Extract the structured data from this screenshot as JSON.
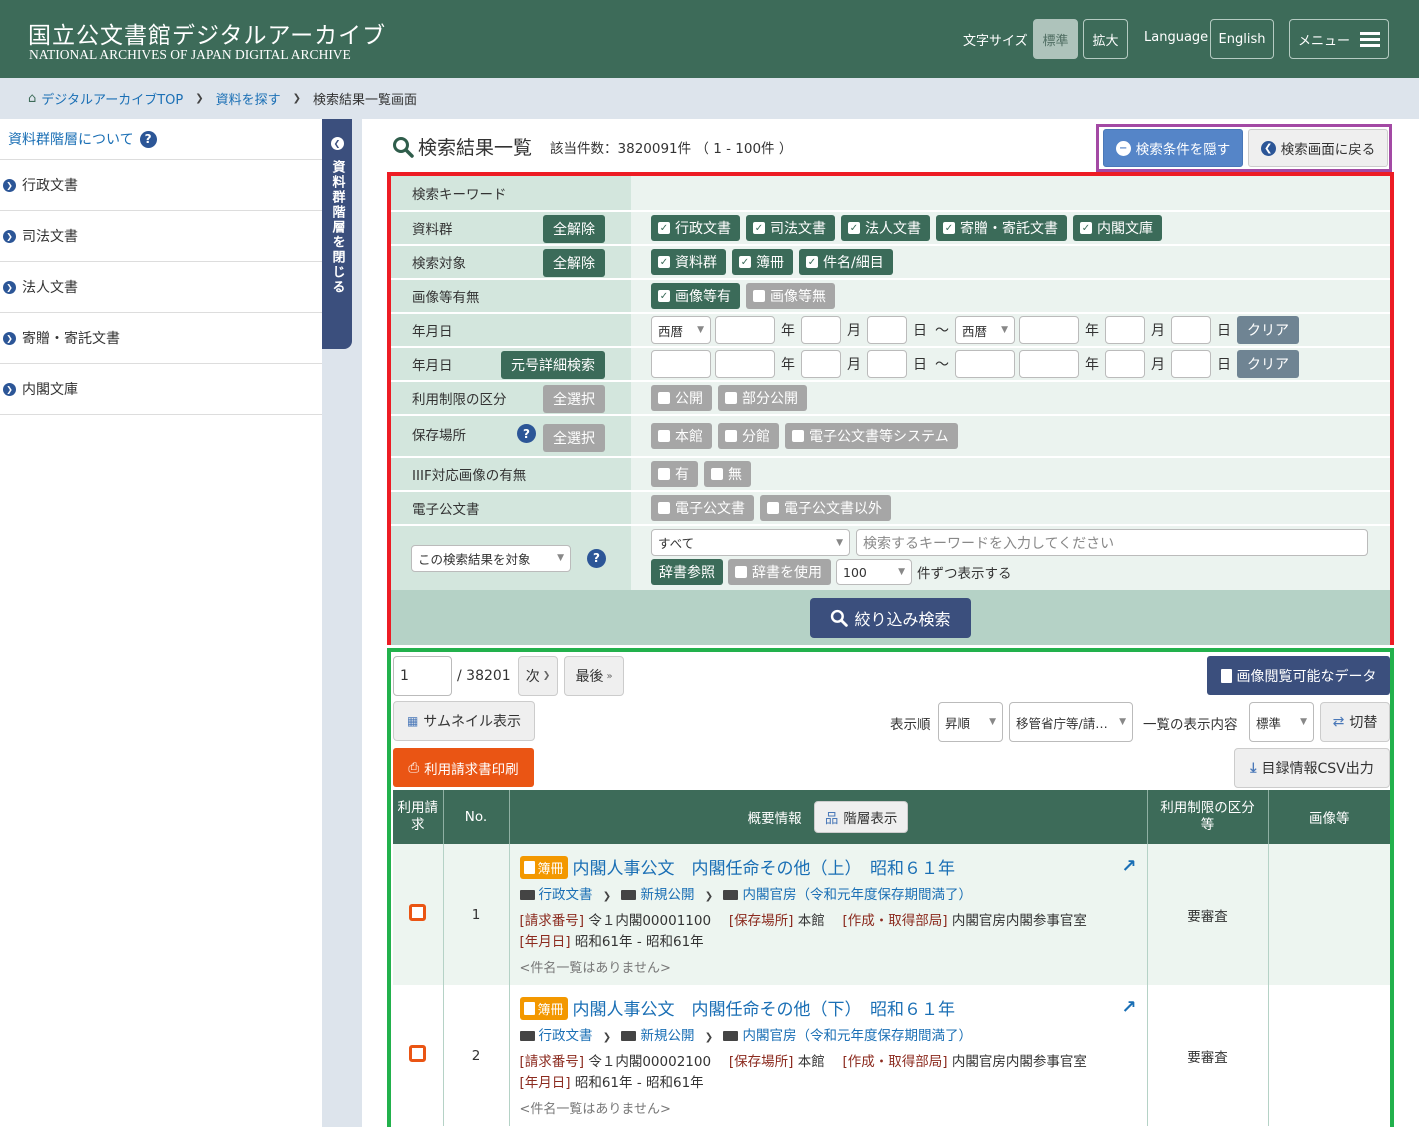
{
  "header": {
    "logo_jp": "国立公文書館デジタルアーカイブ",
    "logo_en": "NATIONAL ARCHIVES OF JAPAN  DIGITAL ARCHIVE",
    "font_size_label": "文字サイズ",
    "font_standard": "標準",
    "font_large": "拡大",
    "language_label": "Language",
    "language_button": "English",
    "menu_button": "メニュー"
  },
  "breadcrumb": {
    "home": "デジタルアーカイブTOP",
    "search": "資料を探す",
    "current": "検索結果一覧画面"
  },
  "sidebar": {
    "about": "資料群階層について",
    "items": [
      "行政文書",
      "司法文書",
      "法人文書",
      "寄贈・寄託文書",
      "内閣文庫"
    ],
    "toggle_label": "資料群階層を閉じる"
  },
  "title": {
    "text": "検索結果一覧",
    "count": "該当件数：3820091件 （ 1 - 100件 ）",
    "hide_conditions": "検索条件を隠す",
    "back_to_search": "検索画面に戻る"
  },
  "search": {
    "keyword_label": "検索キーワード",
    "collection_label": "資料群",
    "collection_btn": "全解除",
    "collections": [
      {
        "label": "行政文書",
        "checked": true
      },
      {
        "label": "司法文書",
        "checked": true
      },
      {
        "label": "法人文書",
        "checked": true
      },
      {
        "label": "寄贈・寄託文書",
        "checked": true
      },
      {
        "label": "内閣文庫",
        "checked": true
      }
    ],
    "target_label": "検索対象",
    "target_btn": "全解除",
    "targets": [
      {
        "label": "資料群",
        "checked": true
      },
      {
        "label": "簿冊",
        "checked": true
      },
      {
        "label": "件名/細目",
        "checked": true
      }
    ],
    "image_label": "画像等有無",
    "images": [
      {
        "label": "画像等有",
        "checked": true
      },
      {
        "label": "画像等無",
        "checked": false
      }
    ],
    "date_label": "年月日",
    "era_select": "西暦",
    "era_select_to": "西暦",
    "unit_year": "年",
    "unit_month": "月",
    "unit_day": "日",
    "tilde": "～",
    "clear": "クリア",
    "date2_label": "年月日",
    "era_detail_btn": "元号詳細検索",
    "restriction_label": "利用制限の区分",
    "restriction_btn": "全選択",
    "restrictions": [
      {
        "label": "公開",
        "checked": false
      },
      {
        "label": "部分公開",
        "checked": false
      }
    ],
    "location_label": "保存場所",
    "location_btn": "全選択",
    "locations": [
      {
        "label": "本館",
        "checked": false
      },
      {
        "label": "分館",
        "checked": false
      },
      {
        "label": "電子公文書等システム",
        "checked": false
      }
    ],
    "iiif_label": "IIIF対応画像の有無",
    "iiif": [
      {
        "label": "有",
        "checked": false
      },
      {
        "label": "無",
        "checked": false
      }
    ],
    "edoc_label": "電子公文書",
    "edoc": [
      {
        "label": "電子公文書",
        "checked": false
      },
      {
        "label": "電子公文書以外",
        "checked": false
      }
    ],
    "scope_select": "この検索結果を対象",
    "field_select": "すべて",
    "keyword_placeholder": "検索するキーワードを入力してください",
    "dict_ref_btn": "辞書参照",
    "use_dict": "辞書を使用",
    "per_page": "100",
    "per_page_suffix": "件ずつ表示する",
    "submit": "絞り込み検索"
  },
  "results": {
    "page_input": "1",
    "page_total": "/ 38201",
    "next": "次",
    "last": "最後",
    "image_data_btn": "画像閲覧可能なデータ",
    "thumbnail_btn": "サムネイル表示",
    "sort_label": "表示順",
    "sort_order": "昇順",
    "sort_key": "移管省庁等/請…",
    "display_label": "一覧の表示内容",
    "display_value": "標準",
    "switch_btn": "切替",
    "print_btn": "利用請求書印刷",
    "csv_btn": "目録情報CSV出力",
    "columns": {
      "request": "利用請求",
      "no": "No.",
      "summary": "概要情報",
      "hierarchy_btn": "階層表示",
      "restriction": "利用制限の区分等",
      "image": "画像等"
    },
    "rows": [
      {
        "no": "1",
        "badge": "簿冊",
        "title": "内閣人事公文　内閣任命その他（上）　昭和６１年",
        "path": [
          "行政文書",
          "新規公開",
          "内閣官房（令和元年度保存期間満了）"
        ],
        "request_no_key": "[請求番号]",
        "request_no": "令１内閣00001100",
        "location_key": "[保存場所]",
        "location": "本館",
        "dept_key": "[作成・取得部局]",
        "dept": "内閣官房内閣参事官室",
        "date_key": "[年月日]",
        "date": "昭和61年 - 昭和61年",
        "note": "<件名一覧はありません>",
        "restriction": "要審査"
      },
      {
        "no": "2",
        "badge": "簿冊",
        "title": "内閣人事公文　内閣任命その他（下）　昭和６１年",
        "path": [
          "行政文書",
          "新規公開",
          "内閣官房（令和元年度保存期間満了）"
        ],
        "request_no_key": "[請求番号]",
        "request_no": "令１内閣00002100",
        "location_key": "[保存場所]",
        "location": "本館",
        "dept_key": "[作成・取得部局]",
        "dept": "内閣官房内閣参事官室",
        "date_key": "[年月日]",
        "date": "昭和61年 - 昭和61年",
        "note": "<件名一覧はありません>",
        "restriction": "要審査"
      }
    ]
  }
}
